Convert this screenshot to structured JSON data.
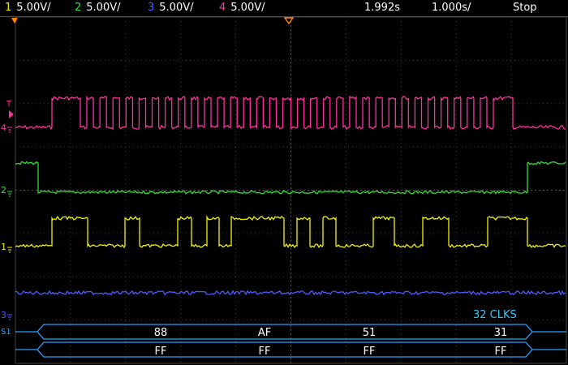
{
  "status": {
    "channels": [
      {
        "num": "1",
        "scale": "5.00V/",
        "color": "#f2f200"
      },
      {
        "num": "2",
        "scale": "5.00V/",
        "color": "#33dd33"
      },
      {
        "num": "3",
        "scale": "5.00V/",
        "color": "#4466ff"
      },
      {
        "num": "4",
        "scale": "5.00V/",
        "color": "#ff2fa0"
      }
    ],
    "timebase": "1.992s",
    "time_per_div": "1.000s/",
    "run_state": "Stop"
  },
  "markers": {
    "ch4_label": "4",
    "ch2_label": "2",
    "ch1_label": "1",
    "ch3_label": "3",
    "trigger_label": "T",
    "bus_label": "S1"
  },
  "decode": {
    "clk_count": "32 CLKS",
    "row1": [
      "88",
      "AF",
      "51",
      "31"
    ],
    "row2": [
      "FF",
      "FF",
      "FF",
      "FF"
    ]
  },
  "colors": {
    "ch1": "#f2f200",
    "ch2": "#33dd33",
    "ch3": "#4a5cff",
    "ch4": "#ff2fa0",
    "bus": "#2aa0ff",
    "grid": "#3c3c3c",
    "clk_text": "#33c8ff"
  }
}
